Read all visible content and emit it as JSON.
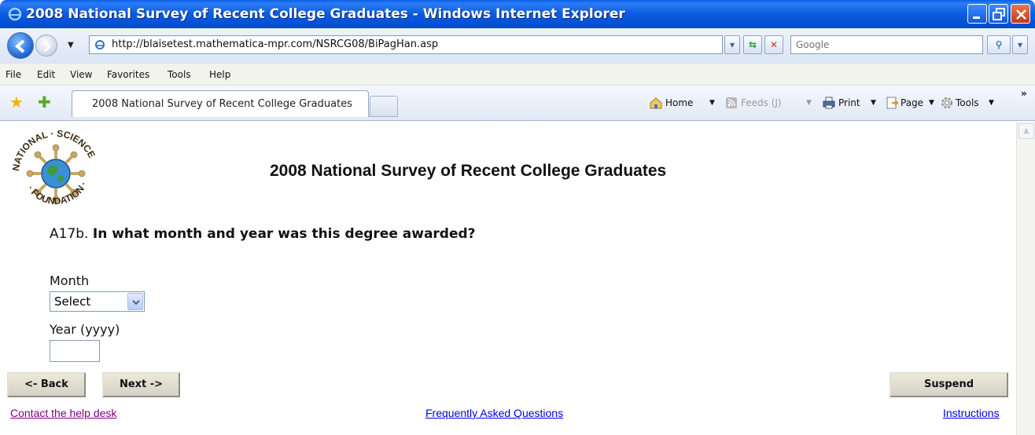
{
  "window": {
    "title": "2008 National Survey of Recent College Graduates - Windows Internet Explorer",
    "controls": [
      "minimize",
      "restore",
      "close"
    ]
  },
  "addressbar": {
    "url": "http://blaisetest.mathematica-mpr.com/NSRCG08/BiPagHan.asp",
    "search_placeholder": "Google"
  },
  "menu": {
    "items": [
      "File",
      "Edit",
      "View",
      "Favorites",
      "Tools",
      "Help"
    ]
  },
  "toolbar": {
    "tab_title": "2008 National Survey of Recent College Graduates",
    "home": "Home",
    "feeds": "Feeds (J)",
    "print": "Print",
    "page": "Page",
    "tools": "Tools",
    "chevron": "»"
  },
  "page": {
    "logo_text": "NATIONAL SCIENCE FOUNDATION",
    "title": "2008 National Survey of Recent College Graduates",
    "question_id": "A17b.",
    "question_text": "In what month and year was this degree awarded?",
    "month_label": "Month",
    "month_value": "Select",
    "year_label": "Year (yyyy)",
    "year_value": "",
    "buttons": {
      "back": "<- Back",
      "next": "Next ->",
      "suspend": "Suspend"
    },
    "links": {
      "help": "Contact the help desk",
      "faq": "Frequently Asked Questions",
      "instructions": "Instructions"
    }
  }
}
